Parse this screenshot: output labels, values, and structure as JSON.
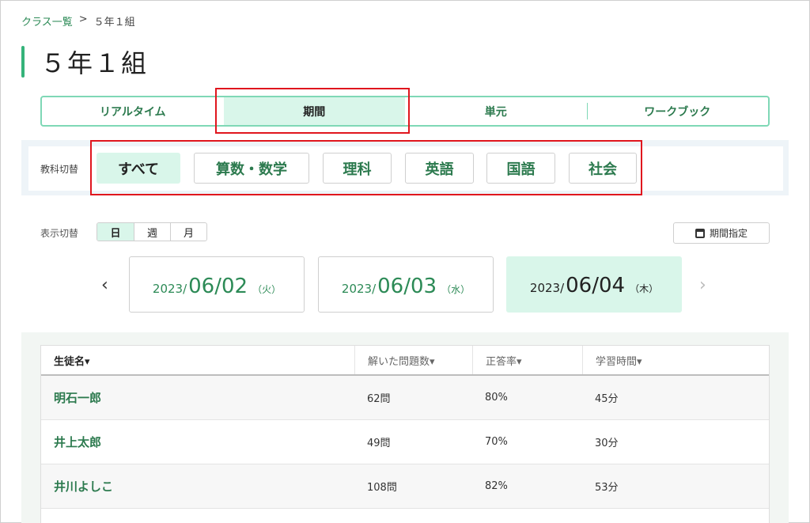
{
  "breadcrumb": {
    "parent": "クラス一覧",
    "separator": ">",
    "current": "５年１組"
  },
  "page_title": "５年１組",
  "tabs": [
    {
      "label": "リアルタイム",
      "active": false
    },
    {
      "label": "期間",
      "active": true
    },
    {
      "label": "単元",
      "active": false
    },
    {
      "label": "ワークブック",
      "active": false
    }
  ],
  "subject_filter": {
    "label": "教科切替",
    "items": [
      {
        "label": "すべて",
        "active": true
      },
      {
        "label": "算数・数学",
        "active": false
      },
      {
        "label": "理科",
        "active": false
      },
      {
        "label": "英語",
        "active": false
      },
      {
        "label": "国語",
        "active": false
      },
      {
        "label": "社会",
        "active": false
      }
    ]
  },
  "display_toggle": {
    "label": "表示切替",
    "options": [
      {
        "label": "日",
        "active": true
      },
      {
        "label": "週",
        "active": false
      },
      {
        "label": "月",
        "active": false
      }
    ]
  },
  "period_button": {
    "label": "期間指定",
    "icon": "calendar-icon"
  },
  "date_nav": {
    "prev_icon": "‹",
    "next_icon": "›",
    "dates": [
      {
        "year": "2023/",
        "md": "06/02",
        "dow": "（火）",
        "active": false
      },
      {
        "year": "2023/",
        "md": "06/03",
        "dow": "（水）",
        "active": false
      },
      {
        "year": "2023/",
        "md": "06/04",
        "dow": "（木）",
        "active": true
      }
    ]
  },
  "table": {
    "headers": [
      "生徒名▾",
      "解いた問題数▾",
      "正答率▾",
      "学習時間▾"
    ],
    "rows": [
      {
        "name": "明石一郎",
        "solved": "62問",
        "rate": "80%",
        "time": "45分"
      },
      {
        "name": "井上太郎",
        "solved": "49問",
        "rate": "70%",
        "time": "30分"
      },
      {
        "name": "井川よしこ",
        "solved": "108問",
        "rate": "82%",
        "time": "53分"
      }
    ]
  },
  "colors": {
    "accent": "#35b37a",
    "active_bg": "#d9f6ea",
    "highlight": "#e0161e",
    "text_green": "#2c7a4e"
  }
}
